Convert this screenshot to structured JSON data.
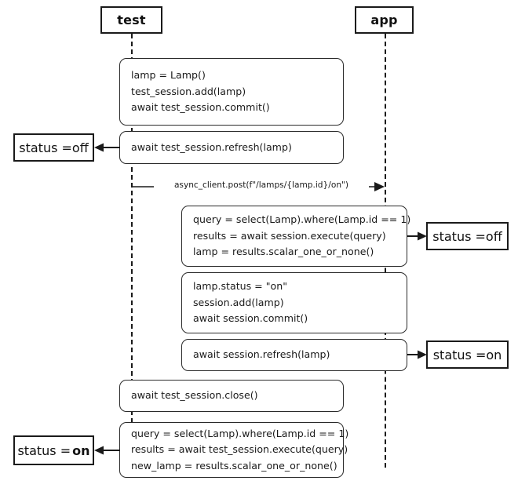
{
  "diagram": {
    "type": "sequence-diagram",
    "title": "",
    "participants": [
      {
        "id": "test",
        "label": "test"
      },
      {
        "id": "app",
        "label": "app"
      }
    ],
    "messages": [
      {
        "id": "http-post",
        "label": "async_client.post(f\"/lamps/{lamp.id}/on\")",
        "from": "test",
        "to": "app",
        "direction": "right"
      }
    ],
    "activities": [
      {
        "id": "act-1",
        "lane": "test",
        "lines": [
          "lamp = Lamp()",
          "test_session.add(lamp)",
          "await test_session.commit()"
        ]
      },
      {
        "id": "act-2",
        "lane": "test",
        "lines": [
          "await test_session.refresh(lamp)"
        ]
      },
      {
        "id": "act-3",
        "lane": "app",
        "lines": [
          "query = select(Lamp).where(Lamp.id == 1)",
          "results = await session.execute(query)",
          "lamp = results.scalar_one_or_none()"
        ]
      },
      {
        "id": "act-4",
        "lane": "app",
        "lines": [
          "lamp.status = \"on\"",
          "session.add(lamp)",
          "await session.commit()"
        ]
      },
      {
        "id": "act-5",
        "lane": "app",
        "lines": [
          "await session.refresh(lamp)"
        ]
      },
      {
        "id": "act-6",
        "lane": "test",
        "lines": [
          "await test_session.close()"
        ]
      },
      {
        "id": "act-7",
        "lane": "test",
        "lines": [
          "query = select(Lamp).where(Lamp.id == 1)",
          "results = await test_session.execute(query)",
          "new_lamp = results.scalar_one_or_none()"
        ]
      }
    ],
    "states": [
      {
        "id": "state-1",
        "prefix": "status = ",
        "value": "off",
        "bold_value": false,
        "side": "left",
        "source": "act-2"
      },
      {
        "id": "state-2",
        "prefix": "status = ",
        "value": "off",
        "bold_value": false,
        "side": "right",
        "source": "act-3"
      },
      {
        "id": "state-3",
        "prefix": "status = ",
        "value": "on",
        "bold_value": false,
        "side": "right",
        "source": "act-5"
      },
      {
        "id": "state-4",
        "prefix": "status = ",
        "value": "on",
        "bold_value": true,
        "side": "left",
        "source": "act-7"
      }
    ],
    "colors": {
      "stroke": "#1a1a1a",
      "box_stroke": "#2a2a2a",
      "background": "#ffffff",
      "text": "#111111"
    }
  }
}
